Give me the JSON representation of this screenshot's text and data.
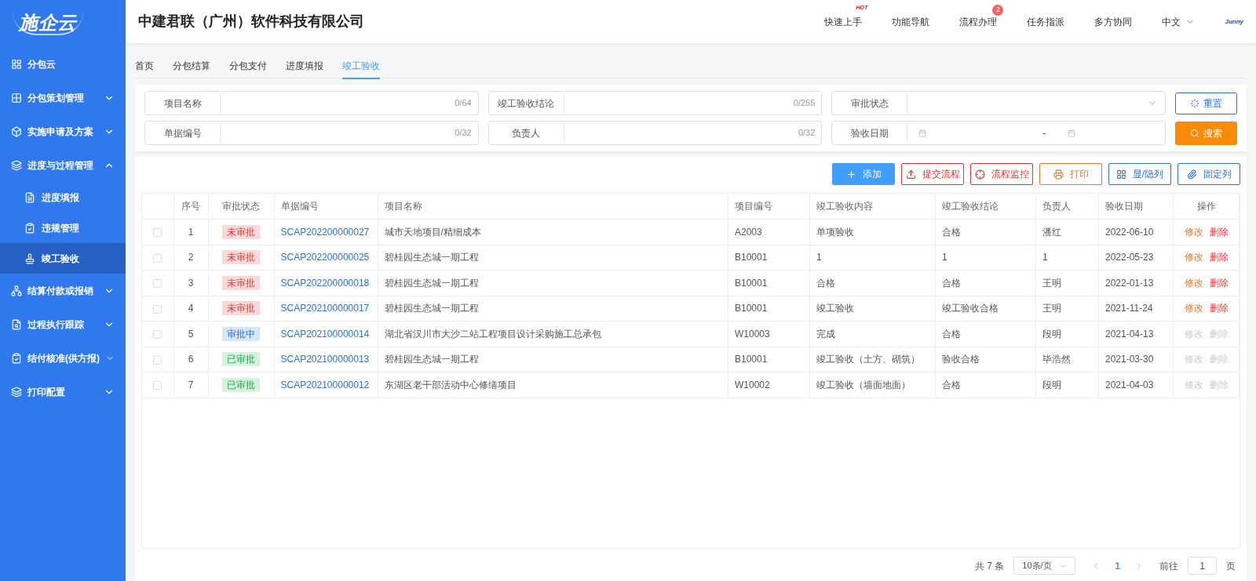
{
  "logo": {
    "text": "施企云"
  },
  "sidebar": {
    "items": [
      {
        "label": "分包云",
        "kind": "link"
      },
      {
        "label": "分包策划管理",
        "kind": "group",
        "expanded": false
      },
      {
        "label": "实施申请及方案",
        "kind": "group",
        "expanded": false
      },
      {
        "label": "进度与过程管理",
        "kind": "group",
        "expanded": true,
        "children": [
          {
            "label": "进度填报",
            "selected": false
          },
          {
            "label": "违规管理",
            "selected": false
          },
          {
            "label": "竣工验收",
            "selected": true
          }
        ]
      },
      {
        "label": "结算付款或报销",
        "kind": "group",
        "expanded": false
      },
      {
        "label": "过程执行跟踪",
        "kind": "group",
        "expanded": false
      },
      {
        "label": "结付核准(供方报)",
        "kind": "group",
        "expanded": false
      },
      {
        "label": "打印配置",
        "kind": "group",
        "expanded": false
      }
    ]
  },
  "header": {
    "company": "中建君联（广州）软件科技有限公司",
    "nav": [
      {
        "label": "快速上手",
        "hot": "HOT"
      },
      {
        "label": "功能导航"
      },
      {
        "label": "流程办理",
        "count": "2"
      },
      {
        "label": "任务指派"
      },
      {
        "label": "多方协同"
      }
    ],
    "language": "中文",
    "brand": "Junny"
  },
  "tabs": [
    {
      "label": "首页",
      "selected": false
    },
    {
      "label": "分包结算",
      "selected": false
    },
    {
      "label": "分包支付",
      "selected": false
    },
    {
      "label": "进度填报",
      "selected": false
    },
    {
      "label": "竣工验收",
      "selected": true
    }
  ],
  "filters": [
    {
      "label": "项目名称",
      "kind": "text",
      "counter": "0/64"
    },
    {
      "label": "竣工验收结论",
      "kind": "text",
      "counter": "0/255"
    },
    {
      "label": "审批状态",
      "kind": "select"
    },
    {
      "label": "单据编号",
      "kind": "text",
      "counter": "0/32"
    },
    {
      "label": "负责人",
      "kind": "text",
      "counter": "0/32"
    },
    {
      "label": "验收日期",
      "kind": "daterange",
      "separator": "-"
    }
  ],
  "filter_buttons": [
    {
      "label": "重置",
      "kind": "reset"
    },
    {
      "label": "搜索",
      "kind": "search"
    }
  ],
  "toolbar": [
    {
      "label": "添加",
      "kind": "primary"
    },
    {
      "label": "提交流程",
      "kind": "danger"
    },
    {
      "label": "流程监控",
      "kind": "danger"
    },
    {
      "label": "打印",
      "kind": "warning"
    },
    {
      "label": "显/隐列",
      "kind": "default"
    },
    {
      "label": "固定列",
      "kind": "default"
    }
  ],
  "table": {
    "columns": [
      "序号",
      "审批状态",
      "单据编号",
      "项目名称",
      "项目编号",
      "竣工验收内容",
      "竣工验收结论",
      "负责人",
      "验收日期",
      "操作"
    ],
    "rows": [
      {
        "checked": false,
        "no": "1",
        "status": {
          "label": "未审批",
          "kind": "pending"
        },
        "doc": "SCAP202200000027",
        "project": "城市天地项目/精细成本",
        "code": "A2003",
        "content": "单项验收",
        "conclusion": "合格",
        "owner": "潘红",
        "date": "2022-06-10",
        "actions": [
          {
            "label": "修改",
            "kind": "edit",
            "disabled": false
          },
          {
            "label": "删除",
            "kind": "delete",
            "disabled": false
          }
        ]
      },
      {
        "checked": false,
        "no": "2",
        "status": {
          "label": "未审批",
          "kind": "pending"
        },
        "doc": "SCAP202200000025",
        "project": "碧桂园生态城一期工程",
        "code": "B10001",
        "content": "1",
        "conclusion": "1",
        "owner": "1",
        "date": "2022-05-23",
        "actions": [
          {
            "label": "修改",
            "kind": "edit",
            "disabled": false
          },
          {
            "label": "删除",
            "kind": "delete",
            "disabled": false
          }
        ]
      },
      {
        "checked": false,
        "no": "3",
        "status": {
          "label": "未审批",
          "kind": "pending"
        },
        "doc": "SCAP202200000018",
        "project": "碧桂园生态城一期工程",
        "code": "B10001",
        "content": "合格",
        "conclusion": "合格",
        "owner": "王明",
        "date": "2022-01-13",
        "actions": [
          {
            "label": "修改",
            "kind": "edit",
            "disabled": false
          },
          {
            "label": "删除",
            "kind": "delete",
            "disabled": false
          }
        ]
      },
      {
        "checked": false,
        "no": "4",
        "status": {
          "label": "未审批",
          "kind": "pending"
        },
        "doc": "SCAP202100000017",
        "project": "碧桂园生态城一期工程",
        "code": "B10001",
        "content": "竣工验收",
        "conclusion": "竣工验收合格",
        "owner": "王明",
        "date": "2021-11-24",
        "actions": [
          {
            "label": "修改",
            "kind": "edit",
            "disabled": false
          },
          {
            "label": "删除",
            "kind": "delete",
            "disabled": false
          }
        ]
      },
      {
        "checked": false,
        "no": "5",
        "status": {
          "label": "审批中",
          "kind": "in_progress"
        },
        "doc": "SCAP202100000014",
        "project": "湖北省汉川市大沙二站工程项目设计采购施工总承包",
        "code": "W10003",
        "content": "完成",
        "conclusion": "合格",
        "owner": "段明",
        "date": "2021-04-13",
        "actions": [
          {
            "label": "修改",
            "kind": "edit",
            "disabled": true
          },
          {
            "label": "删除",
            "kind": "delete",
            "disabled": true
          }
        ]
      },
      {
        "checked": false,
        "no": "6",
        "status": {
          "label": "已审批",
          "kind": "approved"
        },
        "doc": "SCAP202100000013",
        "project": "碧桂园生态城一期工程",
        "code": "B10001",
        "content": "竣工验收（土方、砌筑）",
        "conclusion": "验收合格",
        "owner": "毕浩然",
        "date": "2021-03-30",
        "actions": [
          {
            "label": "修改",
            "kind": "edit",
            "disabled": true
          },
          {
            "label": "删除",
            "kind": "delete",
            "disabled": true
          }
        ]
      },
      {
        "checked": false,
        "no": "7",
        "status": {
          "label": "已审批",
          "kind": "approved"
        },
        "doc": "SCAP202100000012",
        "project": "东湖区老干部活动中心修缮项目",
        "code": "W10002",
        "content": "竣工验收（墙面地面）",
        "conclusion": "合格",
        "owner": "段明",
        "date": "2021-04-03",
        "actions": [
          {
            "label": "修改",
            "kind": "edit",
            "disabled": true
          },
          {
            "label": "删除",
            "kind": "delete",
            "disabled": true
          }
        ]
      }
    ]
  },
  "pagination": {
    "total": "共 7 条",
    "page_size": "10条/页",
    "pages": [
      {
        "label": "1",
        "selected": true
      }
    ],
    "goto_label": "前往",
    "goto_value": "1",
    "goto_suffix": "页"
  }
}
